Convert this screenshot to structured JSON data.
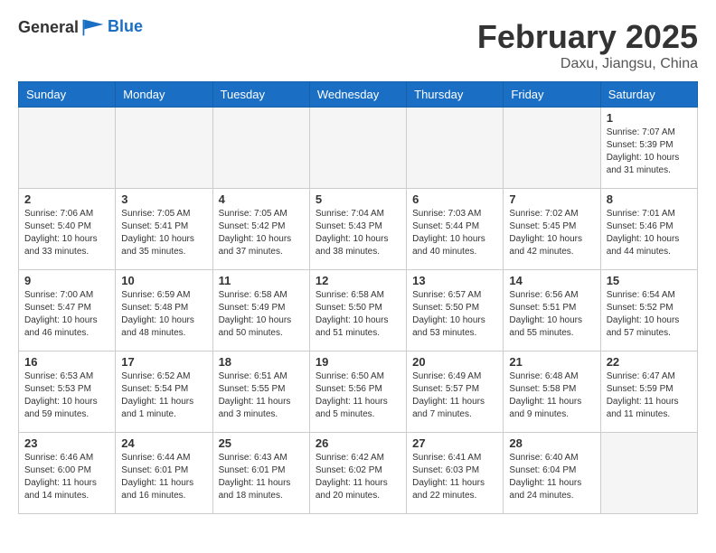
{
  "header": {
    "logo_general": "General",
    "logo_blue": "Blue",
    "month_title": "February 2025",
    "location": "Daxu, Jiangsu, China"
  },
  "weekdays": [
    "Sunday",
    "Monday",
    "Tuesday",
    "Wednesday",
    "Thursday",
    "Friday",
    "Saturday"
  ],
  "weeks": [
    [
      {
        "day": "",
        "info": ""
      },
      {
        "day": "",
        "info": ""
      },
      {
        "day": "",
        "info": ""
      },
      {
        "day": "",
        "info": ""
      },
      {
        "day": "",
        "info": ""
      },
      {
        "day": "",
        "info": ""
      },
      {
        "day": "1",
        "info": "Sunrise: 7:07 AM\nSunset: 5:39 PM\nDaylight: 10 hours\nand 31 minutes."
      }
    ],
    [
      {
        "day": "2",
        "info": "Sunrise: 7:06 AM\nSunset: 5:40 PM\nDaylight: 10 hours\nand 33 minutes."
      },
      {
        "day": "3",
        "info": "Sunrise: 7:05 AM\nSunset: 5:41 PM\nDaylight: 10 hours\nand 35 minutes."
      },
      {
        "day": "4",
        "info": "Sunrise: 7:05 AM\nSunset: 5:42 PM\nDaylight: 10 hours\nand 37 minutes."
      },
      {
        "day": "5",
        "info": "Sunrise: 7:04 AM\nSunset: 5:43 PM\nDaylight: 10 hours\nand 38 minutes."
      },
      {
        "day": "6",
        "info": "Sunrise: 7:03 AM\nSunset: 5:44 PM\nDaylight: 10 hours\nand 40 minutes."
      },
      {
        "day": "7",
        "info": "Sunrise: 7:02 AM\nSunset: 5:45 PM\nDaylight: 10 hours\nand 42 minutes."
      },
      {
        "day": "8",
        "info": "Sunrise: 7:01 AM\nSunset: 5:46 PM\nDaylight: 10 hours\nand 44 minutes."
      }
    ],
    [
      {
        "day": "9",
        "info": "Sunrise: 7:00 AM\nSunset: 5:47 PM\nDaylight: 10 hours\nand 46 minutes."
      },
      {
        "day": "10",
        "info": "Sunrise: 6:59 AM\nSunset: 5:48 PM\nDaylight: 10 hours\nand 48 minutes."
      },
      {
        "day": "11",
        "info": "Sunrise: 6:58 AM\nSunset: 5:49 PM\nDaylight: 10 hours\nand 50 minutes."
      },
      {
        "day": "12",
        "info": "Sunrise: 6:58 AM\nSunset: 5:50 PM\nDaylight: 10 hours\nand 51 minutes."
      },
      {
        "day": "13",
        "info": "Sunrise: 6:57 AM\nSunset: 5:50 PM\nDaylight: 10 hours\nand 53 minutes."
      },
      {
        "day": "14",
        "info": "Sunrise: 6:56 AM\nSunset: 5:51 PM\nDaylight: 10 hours\nand 55 minutes."
      },
      {
        "day": "15",
        "info": "Sunrise: 6:54 AM\nSunset: 5:52 PM\nDaylight: 10 hours\nand 57 minutes."
      }
    ],
    [
      {
        "day": "16",
        "info": "Sunrise: 6:53 AM\nSunset: 5:53 PM\nDaylight: 10 hours\nand 59 minutes."
      },
      {
        "day": "17",
        "info": "Sunrise: 6:52 AM\nSunset: 5:54 PM\nDaylight: 11 hours\nand 1 minute."
      },
      {
        "day": "18",
        "info": "Sunrise: 6:51 AM\nSunset: 5:55 PM\nDaylight: 11 hours\nand 3 minutes."
      },
      {
        "day": "19",
        "info": "Sunrise: 6:50 AM\nSunset: 5:56 PM\nDaylight: 11 hours\nand 5 minutes."
      },
      {
        "day": "20",
        "info": "Sunrise: 6:49 AM\nSunset: 5:57 PM\nDaylight: 11 hours\nand 7 minutes."
      },
      {
        "day": "21",
        "info": "Sunrise: 6:48 AM\nSunset: 5:58 PM\nDaylight: 11 hours\nand 9 minutes."
      },
      {
        "day": "22",
        "info": "Sunrise: 6:47 AM\nSunset: 5:59 PM\nDaylight: 11 hours\nand 11 minutes."
      }
    ],
    [
      {
        "day": "23",
        "info": "Sunrise: 6:46 AM\nSunset: 6:00 PM\nDaylight: 11 hours\nand 14 minutes."
      },
      {
        "day": "24",
        "info": "Sunrise: 6:44 AM\nSunset: 6:01 PM\nDaylight: 11 hours\nand 16 minutes."
      },
      {
        "day": "25",
        "info": "Sunrise: 6:43 AM\nSunset: 6:01 PM\nDaylight: 11 hours\nand 18 minutes."
      },
      {
        "day": "26",
        "info": "Sunrise: 6:42 AM\nSunset: 6:02 PM\nDaylight: 11 hours\nand 20 minutes."
      },
      {
        "day": "27",
        "info": "Sunrise: 6:41 AM\nSunset: 6:03 PM\nDaylight: 11 hours\nand 22 minutes."
      },
      {
        "day": "28",
        "info": "Sunrise: 6:40 AM\nSunset: 6:04 PM\nDaylight: 11 hours\nand 24 minutes."
      },
      {
        "day": "",
        "info": ""
      }
    ]
  ]
}
